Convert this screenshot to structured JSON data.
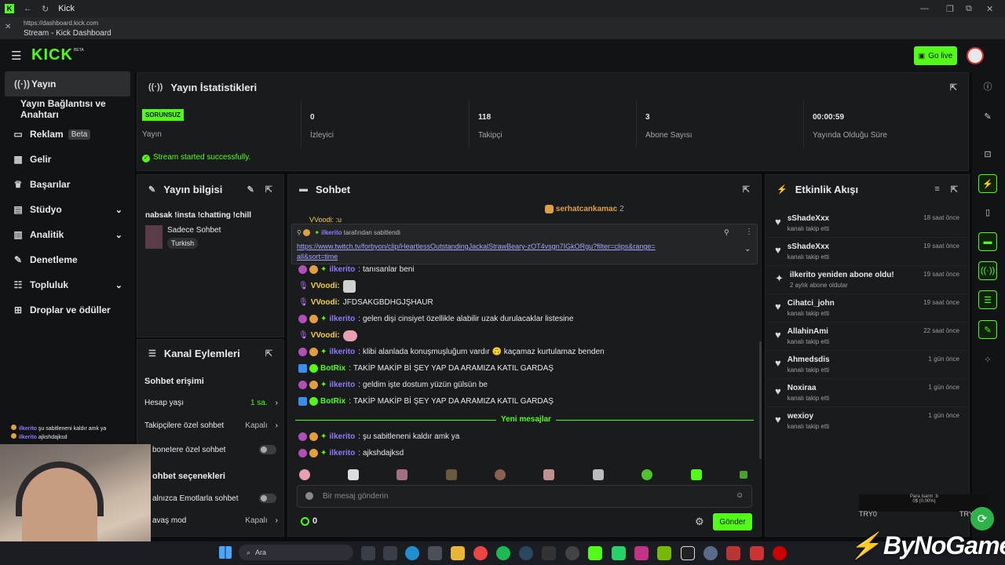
{
  "browser": {
    "tab_title": "Kick",
    "url": "https://dashboard.kick.com",
    "page_title": "Stream - Kick Dashboard"
  },
  "header": {
    "logo": "KICK",
    "logo_beta": "BETA",
    "go_live": "Go live"
  },
  "sidebar": {
    "items": [
      {
        "label": "Yayın",
        "icon": "stream-icon"
      },
      {
        "label": "Yayın Bağlantısı ve Anahtarı",
        "icon": ""
      },
      {
        "label": "Reklam",
        "badge": "Beta",
        "icon": "ad-icon"
      },
      {
        "label": "Gelir",
        "icon": "revenue-icon"
      },
      {
        "label": "Başarılar",
        "icon": "trophy-icon"
      },
      {
        "label": "Stüdyo",
        "icon": "studio-icon"
      },
      {
        "label": "Analitik",
        "icon": "chart-icon"
      },
      {
        "label": "Denetleme",
        "icon": "wrench-icon"
      },
      {
        "label": "Topluluk",
        "icon": "community-icon"
      },
      {
        "label": "Droplar ve ödüller",
        "icon": "gift-icon"
      }
    ]
  },
  "stats": {
    "title": "Yayın İstatistikleri",
    "status_badge": "SORUNSUZ",
    "status_label": "Yayın",
    "items": [
      {
        "value": "0",
        "label": "İzleyici"
      },
      {
        "value": "118",
        "label": "Takipçi"
      },
      {
        "value": "3",
        "label": "Abone Sayısı"
      },
      {
        "value": "00:00:59",
        "label": "Yayında Olduğu Süre"
      }
    ],
    "success": "Stream started successfully."
  },
  "info": {
    "title": "Yayın bilgisi",
    "stream_title": "nabsak !insta !chatting !chill",
    "category": "Sadece Sohbet",
    "tag": "Turkish"
  },
  "channel": {
    "title": "Kanal Eylemleri",
    "chat_access": "Sohbet erişimi",
    "account_age": "Hesap yaşı",
    "account_age_val": "1 sa.",
    "followers_only": "Takipçilere özel sohbet",
    "followers_only_val": "Kapalı",
    "subs_only": "boneIere özel sohbet",
    "chat_options": "ohbet seçenekleri",
    "emote_only": "alnızca Emotlarla sohbet",
    "slow_mode": "avaş mod",
    "slow_mode_val": "Kapalı"
  },
  "chat": {
    "title": "Sohbet",
    "top_user": "serhatcankamac",
    "top_count": "2",
    "partial_line": "VVoodi: :u",
    "pinned_by_user": "ilkerito",
    "pinned_by_text": "tarafından sabitlendi",
    "pinned_link": "https://www.twitch.tv/forbyon/clip/HeartlessOutstandingJackalStrawBeary-zOT4vsgn7IGkORgu?filter=clips&range=all&sort=time",
    "messages": [
      {
        "user": "ilkerito",
        "text": "tanısanlar beni",
        "color": "#8b7dff"
      },
      {
        "user": "VVoodi:",
        "text": "",
        "color": "#f5d142"
      },
      {
        "user": "VVoodi:",
        "text": "JFDSAKGBDHGJŞHAUR",
        "color": "#f5d142"
      },
      {
        "user": "ilkerito",
        "text": "gelen dişi cinsiyet özellikle alabilir uzak durulacaklar listesine",
        "color": "#8b7dff"
      },
      {
        "user": "VVoodi:",
        "text": "",
        "color": "#f5d142"
      },
      {
        "user": "ilkerito",
        "text": "klibi alanlada konuşmuşluğum vardır 🙃 kaçamaz kurtulamaz benden",
        "color": "#8b7dff"
      },
      {
        "user": "BotRix",
        "text": "TAKİP MAKİP Bİ ŞEY YAP DA ARAMIZA KATIL GARDAŞ",
        "color": "#53fc18"
      },
      {
        "user": "ilkerito",
        "text": "geldim işte dostum yüzün gülsün be",
        "color": "#8b7dff"
      },
      {
        "user": "BotRix",
        "text": "TAKİP MAKİP Bİ ŞEY YAP DA ARAMIZA KATIL GARDAŞ",
        "color": "#53fc18"
      }
    ],
    "new_messages": "Yeni mesajlar",
    "messages2": [
      {
        "user": "ilkerito",
        "text": "şu sabitleneni kaldır amk ya",
        "color": "#8b7dff"
      },
      {
        "user": "ilkerito",
        "text": "ajkshdajksd",
        "color": "#8b7dff"
      }
    ],
    "input_placeholder": "Bir mesaj gönderin",
    "points": "0",
    "send": "Gönder"
  },
  "activity": {
    "title": "Etkinlik Akışı",
    "events": [
      {
        "name": "sShadeXxx",
        "sub": "kanalı takip etti",
        "time": "18 saat önce"
      },
      {
        "name": "sShadeXxx",
        "sub": "kanalı takip etti",
        "time": "19 saat önce"
      },
      {
        "name": "ilkerito yeniden abone oldu!",
        "sub": "2 aylık abone oldular",
        "time": "19 saat önce"
      },
      {
        "name": "Cihatci_john",
        "sub": "kanalı takip etti",
        "time": "19 saat önce"
      },
      {
        "name": "AllahinAmi",
        "sub": "kanalı takip etti",
        "time": "22 saat önce"
      },
      {
        "name": "Ahmedsdis",
        "sub": "kanalı takip etti",
        "time": "1 gün önce"
      },
      {
        "name": "Noxiraa",
        "sub": "kanalı takip etti",
        "time": "1 gün önce"
      },
      {
        "name": "wexioy",
        "sub": "kanalı takip etti",
        "time": "1 gün önce"
      }
    ]
  },
  "overlay": {
    "line1_user": "ilkerito",
    "line1_text": "şu sabitleneni kaldır amk ya",
    "line2_user": "ilkerito",
    "line2_text": "ajkshdajksd",
    "watermark": "ByNoGame",
    "tryo": "TRY0",
    "tryo2": "TRY",
    "mini_text": "Para Isarm :b",
    "mini_val": "0$ (0.00%)"
  },
  "taskbar": {
    "search": "Ara"
  },
  "colors": {
    "accent": "#53fc18",
    "panel": "#191b1c",
    "bg": "#0b0c0d"
  }
}
